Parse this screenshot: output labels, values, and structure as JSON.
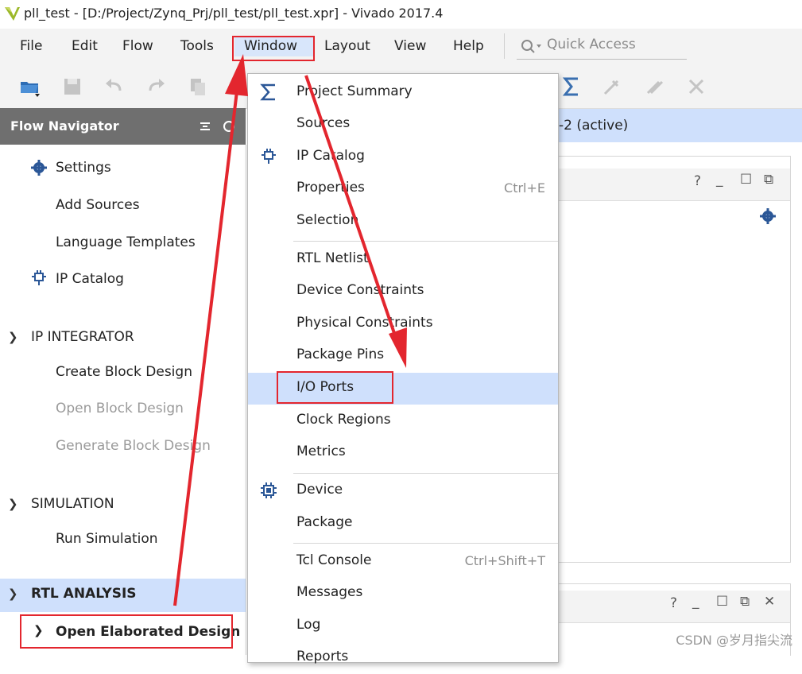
{
  "window": {
    "title": "pll_test - [D:/Project/Zynq_Prj/pll_test/pll_test.xpr] - Vivado 2017.4"
  },
  "menubar": {
    "items": [
      {
        "label": "File"
      },
      {
        "label": "Edit"
      },
      {
        "label": "Flow"
      },
      {
        "label": "Tools"
      },
      {
        "label": "Window"
      },
      {
        "label": "Layout"
      },
      {
        "label": "View"
      },
      {
        "label": "Help"
      }
    ],
    "active": "Window",
    "quick_access_placeholder": "Quick Access"
  },
  "flow_navigator": {
    "title": "Flow Navigator",
    "project_manager_items": [
      "Settings",
      "Add Sources",
      "Language Templates",
      "IP Catalog"
    ],
    "ip_integrator": {
      "label": "IP INTEGRATOR",
      "items": [
        "Create Block Design",
        "Open Block Design",
        "Generate Block Design"
      ]
    },
    "simulation": {
      "label": "SIMULATION",
      "items": [
        "Run Simulation"
      ]
    },
    "rtl_analysis": {
      "label": "RTL ANALYSIS",
      "items": [
        "Open Elaborated Design"
      ]
    }
  },
  "background": {
    "active_strip_text": "-2  (active)"
  },
  "window_menu": {
    "group1": [
      {
        "label": "Project Summary",
        "icon": "sigma-icon"
      },
      {
        "label": "Sources",
        "icon": ""
      },
      {
        "label": "IP Catalog",
        "icon": "ip-catalog-icon"
      },
      {
        "label": "Properties",
        "shortcut": "Ctrl+E"
      },
      {
        "label": "Selection"
      }
    ],
    "group2": [
      {
        "label": "RTL Netlist"
      },
      {
        "label": "Device Constraints"
      },
      {
        "label": "Physical Constraints"
      },
      {
        "label": "Package Pins"
      },
      {
        "label": "I/O Ports",
        "highlighted": true
      },
      {
        "label": "Clock Regions"
      },
      {
        "label": "Metrics"
      }
    ],
    "group3": [
      {
        "label": "Device",
        "icon": "chip-icon"
      },
      {
        "label": "Package"
      }
    ],
    "group4": [
      {
        "label": "Tcl Console",
        "shortcut": "Ctrl+Shift+T"
      },
      {
        "label": "Messages"
      },
      {
        "label": "Log"
      },
      {
        "label": "Reports"
      }
    ]
  },
  "watermark": "CSDN @岁月指尖流",
  "colors": {
    "highlight": "#cfe0fc",
    "annotation_red": "#e3262e",
    "nav_header": "#6f6f6f"
  }
}
